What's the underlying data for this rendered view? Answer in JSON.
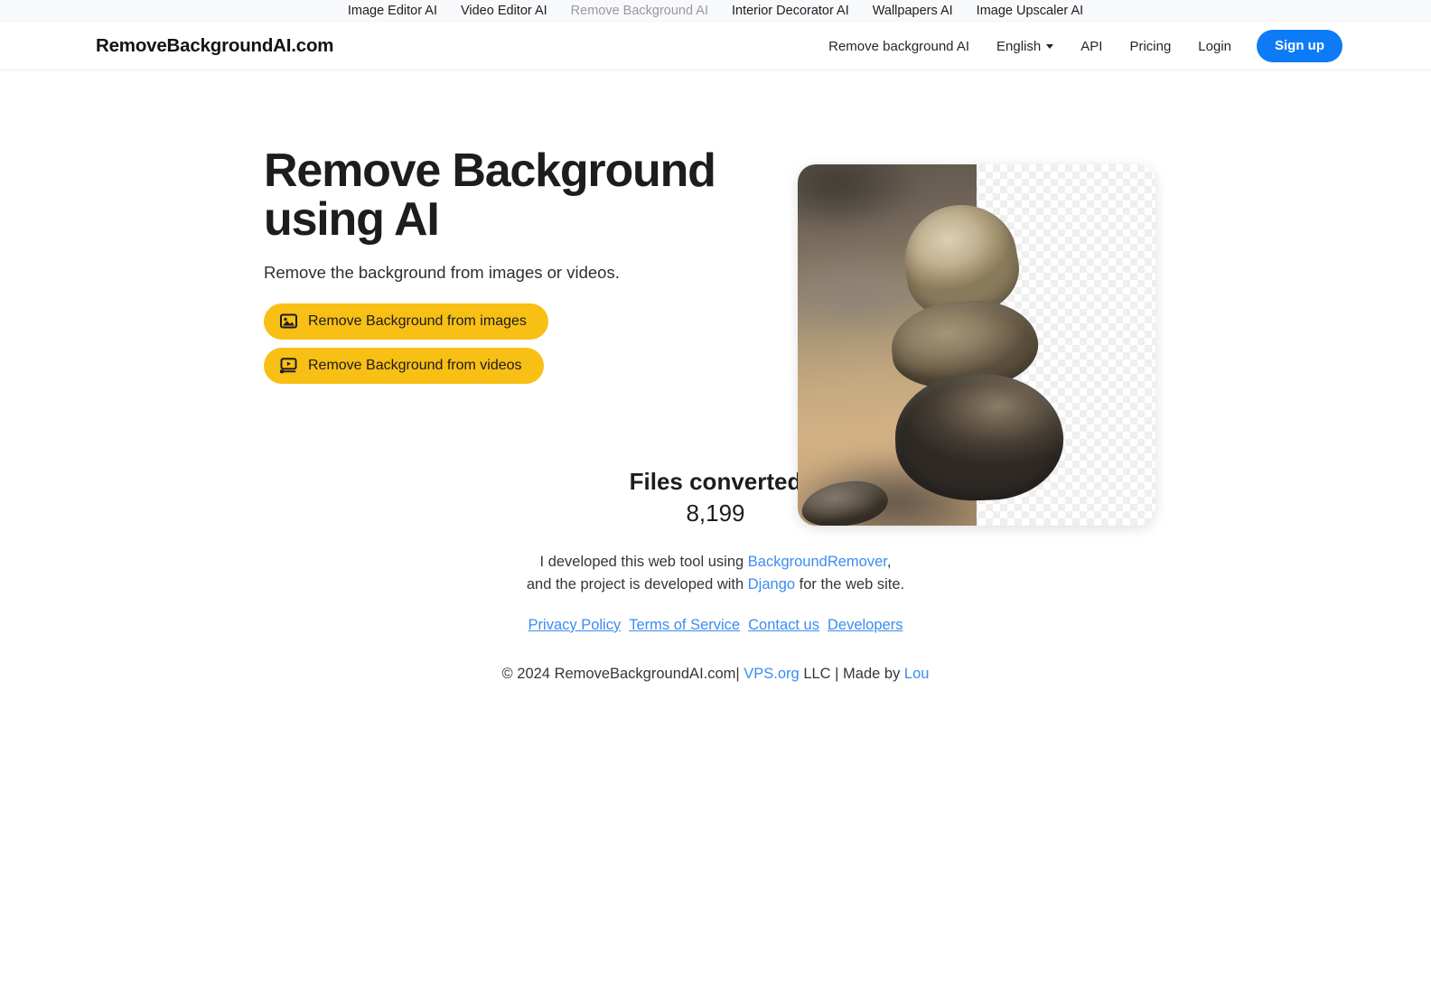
{
  "topstrip": {
    "items": [
      {
        "label": "Image Editor AI",
        "current": false
      },
      {
        "label": "Video Editor AI",
        "current": false
      },
      {
        "label": "Remove Background AI",
        "current": true
      },
      {
        "label": "Interior Decorator AI",
        "current": false
      },
      {
        "label": "Wallpapers AI",
        "current": false
      },
      {
        "label": "Image Upscaler AI",
        "current": false
      }
    ]
  },
  "header": {
    "brand": "RemoveBackgroundAI.com",
    "nav": [
      {
        "label": "Remove background AI"
      },
      {
        "label": "API"
      },
      {
        "label": "Pricing"
      },
      {
        "label": "Login"
      }
    ],
    "language": "English",
    "signup_label": "Sign up"
  },
  "hero": {
    "title": "Remove Background using AI",
    "subtitle": "Remove the background from images or videos.",
    "cta": [
      {
        "label": "Remove Background from images",
        "icon": "image-icon"
      },
      {
        "label": "Remove Background from videos",
        "icon": "video-icon"
      }
    ],
    "image_alt": "Before and after background removal of stacked rocks"
  },
  "stats": {
    "label": "Files converted",
    "value": "8,199"
  },
  "credits": {
    "line1_before": "I developed this web tool using ",
    "line1_link": "BackgroundRemover",
    "line1_after": ",",
    "line2_before": "and the project is developed with ",
    "line2_link": "Django",
    "line2_after": " for the web site."
  },
  "footer_links": [
    {
      "label": "Privacy Policy"
    },
    {
      "label": "Terms of Service"
    },
    {
      "label": "Contact us"
    },
    {
      "label": "Developers"
    }
  ],
  "copyright": {
    "before": "© 2024 RemoveBackgroundAI.com| ",
    "link1": "VPS.org",
    "middle": " LLC | Made by ",
    "link2": "Lou"
  },
  "colors": {
    "accent_yellow": "#f8bf14",
    "primary_blue": "#0d7bf7",
    "link_blue": "#3b8cf0",
    "strip_bg": "#f8f9fa"
  }
}
